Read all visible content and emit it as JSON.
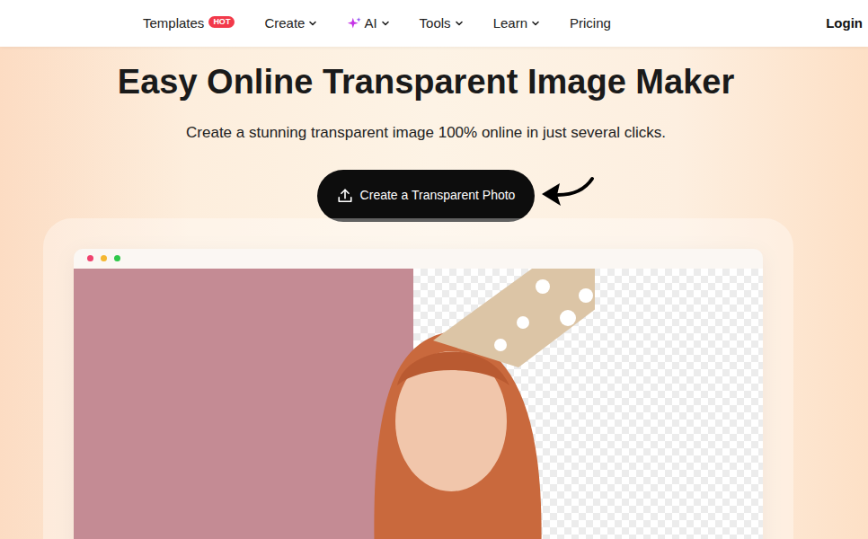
{
  "nav": {
    "items": [
      {
        "label": "Templates",
        "kind": "hot",
        "badge": "HOT"
      },
      {
        "label": "Create",
        "kind": "menu"
      },
      {
        "label": "AI",
        "kind": "ai-menu"
      },
      {
        "label": "Tools",
        "kind": "menu"
      },
      {
        "label": "Learn",
        "kind": "menu"
      },
      {
        "label": "Pricing",
        "kind": "link"
      }
    ],
    "login": "Login"
  },
  "hero": {
    "title": "Easy Online Transparent Image Maker",
    "subtitle": "Create a stunning transparent image 100% online in just several clicks.",
    "button": "Create a Transparent Photo"
  },
  "preview": {
    "dots": [
      {
        "color": "#f0426e"
      },
      {
        "color": "#f5b731"
      },
      {
        "color": "#2fc84a"
      }
    ]
  }
}
